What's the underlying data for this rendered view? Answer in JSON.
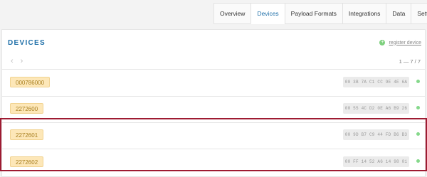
{
  "tabs": [
    {
      "label": "Overview",
      "active": false
    },
    {
      "label": "Devices",
      "active": true
    },
    {
      "label": "Payload Formats",
      "active": false
    },
    {
      "label": "Integrations",
      "active": false
    },
    {
      "label": "Data",
      "active": false
    },
    {
      "label": "Settings",
      "active": false
    }
  ],
  "devices_card": {
    "title": "DEVICES",
    "register_label": "register device",
    "register_icon": "plus-circle-icon",
    "pager": {
      "prev_icon": "chevron-left-icon",
      "next_icon": "chevron-right-icon",
      "count": "1 — 7 / 7"
    }
  },
  "devices": [
    {
      "id": "000786000",
      "eui": "00 3B 7A C1 CC 9E 4E 6A",
      "status": "online"
    },
    {
      "id": "2272600",
      "eui": "00 55 4C D2 0E A6 B9 26",
      "status": "online"
    },
    {
      "id": "2272601",
      "eui": "00 9D B7 C9 44 FD B6 B3",
      "status": "online"
    },
    {
      "id": "2272602",
      "eui": "00 FF 14 52 A6 14 98 01",
      "status": "online"
    }
  ],
  "colors": {
    "accent": "#1e6fa8",
    "highlight": "#9e1b32",
    "status_online": "#85d88b",
    "device_badge": "#fde7b8"
  }
}
